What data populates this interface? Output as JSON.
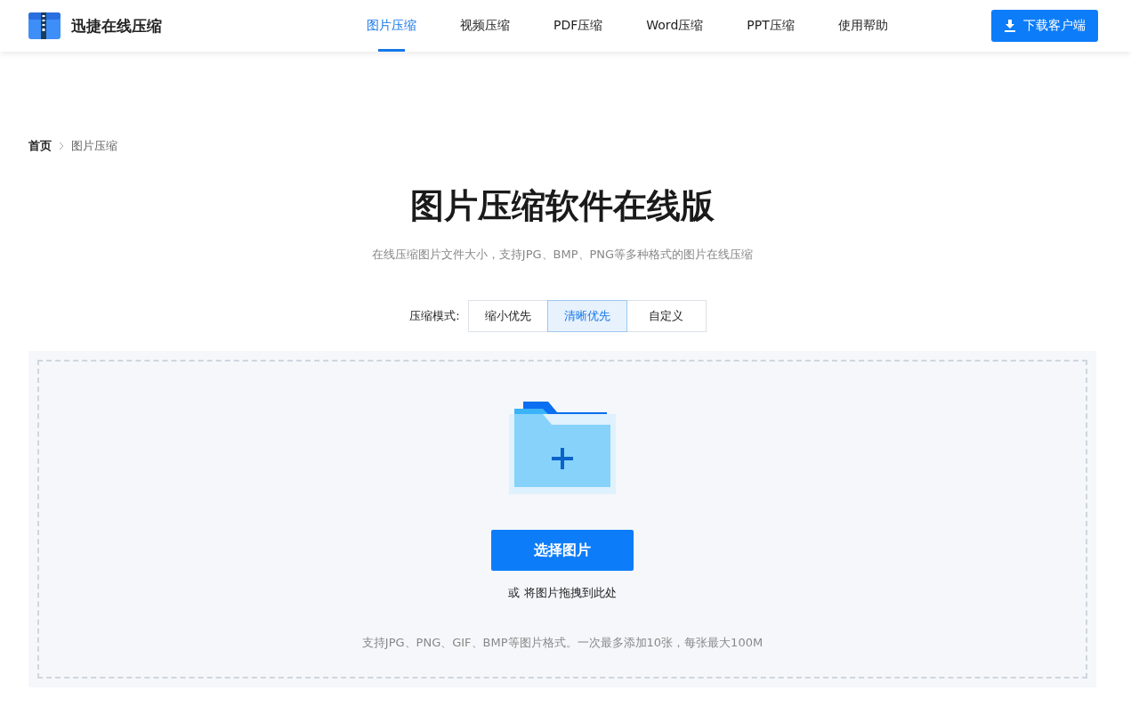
{
  "header": {
    "logo_text": "迅捷在线压缩",
    "nav": [
      {
        "label": "图片压缩",
        "selected": true
      },
      {
        "label": "视频压缩",
        "selected": false
      },
      {
        "label": "PDF压缩",
        "selected": false
      },
      {
        "label": "Word压缩",
        "selected": false
      },
      {
        "label": "PPT压缩",
        "selected": false
      },
      {
        "label": "使用帮助",
        "selected": false
      }
    ],
    "download_button": "下载客户端"
  },
  "breadcrumb": [
    "首页",
    "图片压缩"
  ],
  "title": "图片压缩软件在线版",
  "subtitle": "在线压缩图片文件大小，支持JPG、BMP、PNG等多种格式的图片在线压缩",
  "mode": {
    "label": "压缩模式:",
    "options": [
      {
        "label": "缩小优先",
        "selected": false
      },
      {
        "label": "清晰优先",
        "selected": true
      },
      {
        "label": "自定义",
        "selected": false
      }
    ]
  },
  "upload": {
    "button": "选择图片",
    "drop_hint": "或 将图片拖拽到此处",
    "note": "支持JPG、PNG、GIF、BMP等图片格式。一次最多添加10张，每张最大100M"
  }
}
